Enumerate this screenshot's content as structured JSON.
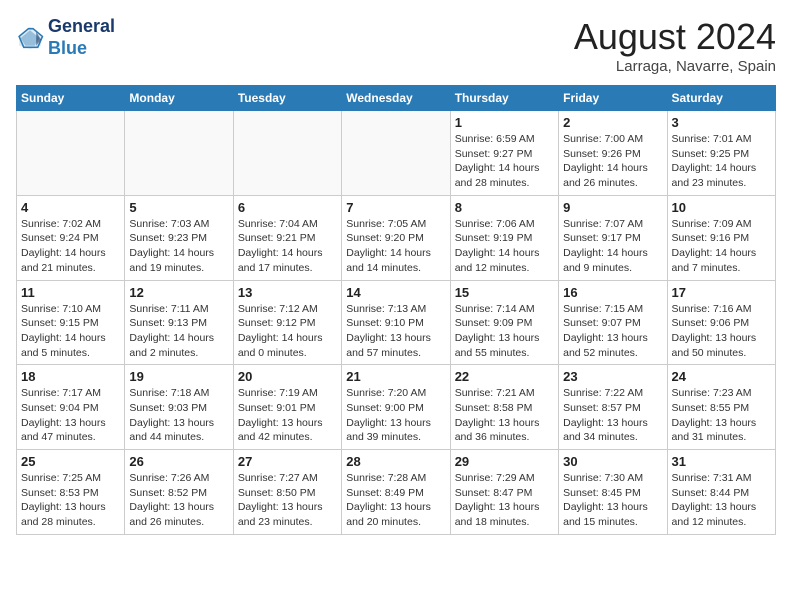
{
  "header": {
    "logo_line1": "General",
    "logo_line2": "Blue",
    "month": "August 2024",
    "location": "Larraga, Navarre, Spain"
  },
  "weekdays": [
    "Sunday",
    "Monday",
    "Tuesday",
    "Wednesday",
    "Thursday",
    "Friday",
    "Saturday"
  ],
  "weeks": [
    [
      {
        "day": "",
        "info": ""
      },
      {
        "day": "",
        "info": ""
      },
      {
        "day": "",
        "info": ""
      },
      {
        "day": "",
        "info": ""
      },
      {
        "day": "1",
        "info": "Sunrise: 6:59 AM\nSunset: 9:27 PM\nDaylight: 14 hours\nand 28 minutes."
      },
      {
        "day": "2",
        "info": "Sunrise: 7:00 AM\nSunset: 9:26 PM\nDaylight: 14 hours\nand 26 minutes."
      },
      {
        "day": "3",
        "info": "Sunrise: 7:01 AM\nSunset: 9:25 PM\nDaylight: 14 hours\nand 23 minutes."
      }
    ],
    [
      {
        "day": "4",
        "info": "Sunrise: 7:02 AM\nSunset: 9:24 PM\nDaylight: 14 hours\nand 21 minutes."
      },
      {
        "day": "5",
        "info": "Sunrise: 7:03 AM\nSunset: 9:23 PM\nDaylight: 14 hours\nand 19 minutes."
      },
      {
        "day": "6",
        "info": "Sunrise: 7:04 AM\nSunset: 9:21 PM\nDaylight: 14 hours\nand 17 minutes."
      },
      {
        "day": "7",
        "info": "Sunrise: 7:05 AM\nSunset: 9:20 PM\nDaylight: 14 hours\nand 14 minutes."
      },
      {
        "day": "8",
        "info": "Sunrise: 7:06 AM\nSunset: 9:19 PM\nDaylight: 14 hours\nand 12 minutes."
      },
      {
        "day": "9",
        "info": "Sunrise: 7:07 AM\nSunset: 9:17 PM\nDaylight: 14 hours\nand 9 minutes."
      },
      {
        "day": "10",
        "info": "Sunrise: 7:09 AM\nSunset: 9:16 PM\nDaylight: 14 hours\nand 7 minutes."
      }
    ],
    [
      {
        "day": "11",
        "info": "Sunrise: 7:10 AM\nSunset: 9:15 PM\nDaylight: 14 hours\nand 5 minutes."
      },
      {
        "day": "12",
        "info": "Sunrise: 7:11 AM\nSunset: 9:13 PM\nDaylight: 14 hours\nand 2 minutes."
      },
      {
        "day": "13",
        "info": "Sunrise: 7:12 AM\nSunset: 9:12 PM\nDaylight: 14 hours\nand 0 minutes."
      },
      {
        "day": "14",
        "info": "Sunrise: 7:13 AM\nSunset: 9:10 PM\nDaylight: 13 hours\nand 57 minutes."
      },
      {
        "day": "15",
        "info": "Sunrise: 7:14 AM\nSunset: 9:09 PM\nDaylight: 13 hours\nand 55 minutes."
      },
      {
        "day": "16",
        "info": "Sunrise: 7:15 AM\nSunset: 9:07 PM\nDaylight: 13 hours\nand 52 minutes."
      },
      {
        "day": "17",
        "info": "Sunrise: 7:16 AM\nSunset: 9:06 PM\nDaylight: 13 hours\nand 50 minutes."
      }
    ],
    [
      {
        "day": "18",
        "info": "Sunrise: 7:17 AM\nSunset: 9:04 PM\nDaylight: 13 hours\nand 47 minutes."
      },
      {
        "day": "19",
        "info": "Sunrise: 7:18 AM\nSunset: 9:03 PM\nDaylight: 13 hours\nand 44 minutes."
      },
      {
        "day": "20",
        "info": "Sunrise: 7:19 AM\nSunset: 9:01 PM\nDaylight: 13 hours\nand 42 minutes."
      },
      {
        "day": "21",
        "info": "Sunrise: 7:20 AM\nSunset: 9:00 PM\nDaylight: 13 hours\nand 39 minutes."
      },
      {
        "day": "22",
        "info": "Sunrise: 7:21 AM\nSunset: 8:58 PM\nDaylight: 13 hours\nand 36 minutes."
      },
      {
        "day": "23",
        "info": "Sunrise: 7:22 AM\nSunset: 8:57 PM\nDaylight: 13 hours\nand 34 minutes."
      },
      {
        "day": "24",
        "info": "Sunrise: 7:23 AM\nSunset: 8:55 PM\nDaylight: 13 hours\nand 31 minutes."
      }
    ],
    [
      {
        "day": "25",
        "info": "Sunrise: 7:25 AM\nSunset: 8:53 PM\nDaylight: 13 hours\nand 28 minutes."
      },
      {
        "day": "26",
        "info": "Sunrise: 7:26 AM\nSunset: 8:52 PM\nDaylight: 13 hours\nand 26 minutes."
      },
      {
        "day": "27",
        "info": "Sunrise: 7:27 AM\nSunset: 8:50 PM\nDaylight: 13 hours\nand 23 minutes."
      },
      {
        "day": "28",
        "info": "Sunrise: 7:28 AM\nSunset: 8:49 PM\nDaylight: 13 hours\nand 20 minutes."
      },
      {
        "day": "29",
        "info": "Sunrise: 7:29 AM\nSunset: 8:47 PM\nDaylight: 13 hours\nand 18 minutes."
      },
      {
        "day": "30",
        "info": "Sunrise: 7:30 AM\nSunset: 8:45 PM\nDaylight: 13 hours\nand 15 minutes."
      },
      {
        "day": "31",
        "info": "Sunrise: 7:31 AM\nSunset: 8:44 PM\nDaylight: 13 hours\nand 12 minutes."
      }
    ]
  ]
}
